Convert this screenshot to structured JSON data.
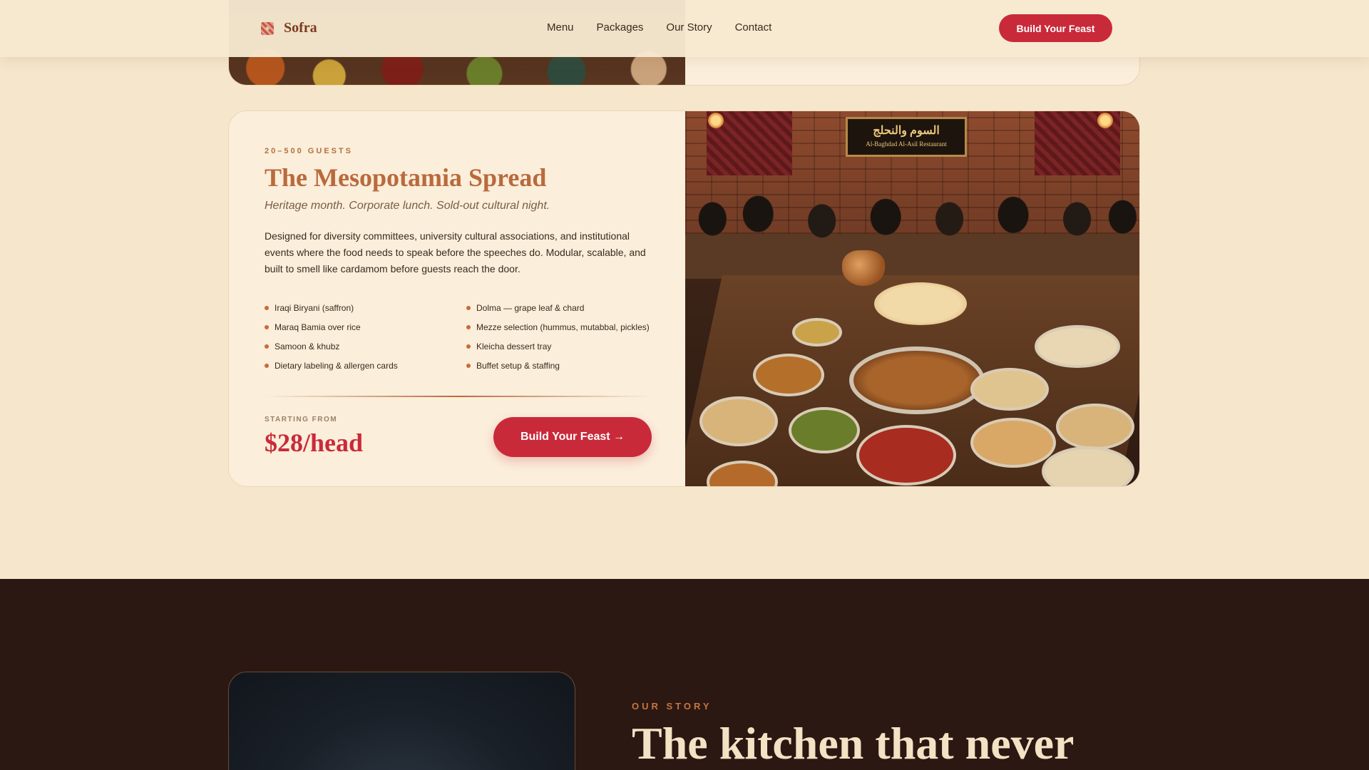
{
  "header": {
    "brand": "Sofra",
    "nav": [
      "Menu",
      "Packages",
      "Our Story",
      "Contact"
    ],
    "cta_label": "Build Your Feast"
  },
  "package": {
    "eyebrow": "20–500 GUESTS",
    "title": "The Mesopotamia Spread",
    "subtitle": "Heritage month. Corporate lunch. Sold-out cultural night.",
    "description": "Designed for diversity committees, university cultural associations, and institutional events where the food needs to speak before the speeches do. Modular, scalable, and built to smell like cardamom before guests reach the door.",
    "features": [
      "Iraqi Biryani (saffron)",
      "Dolma — grape leaf & chard",
      "Maraq Bamia over rice",
      "Mezze selection (hummus, mutabbal, pickles)",
      "Samoon & khubz",
      "Kleicha dessert tray",
      "Dietary labeling & allergen cards",
      "Buffet setup & staffing"
    ],
    "price_label": "STARTING FROM",
    "price": "$28/head",
    "cta_label": "Build Your Feast →",
    "photo": {
      "sign_arabic": "السوم والنحلج",
      "sign_english": "Al-Baghdad Al-Asil Restaurant"
    }
  },
  "story": {
    "eyebrow": "OUR STORY",
    "title": "The kitchen that never"
  },
  "colors": {
    "background": "#f5e6cc",
    "accent_red": "#c92a3a",
    "accent_copper": "#b96a3c",
    "dark_section": "#2b1812"
  }
}
